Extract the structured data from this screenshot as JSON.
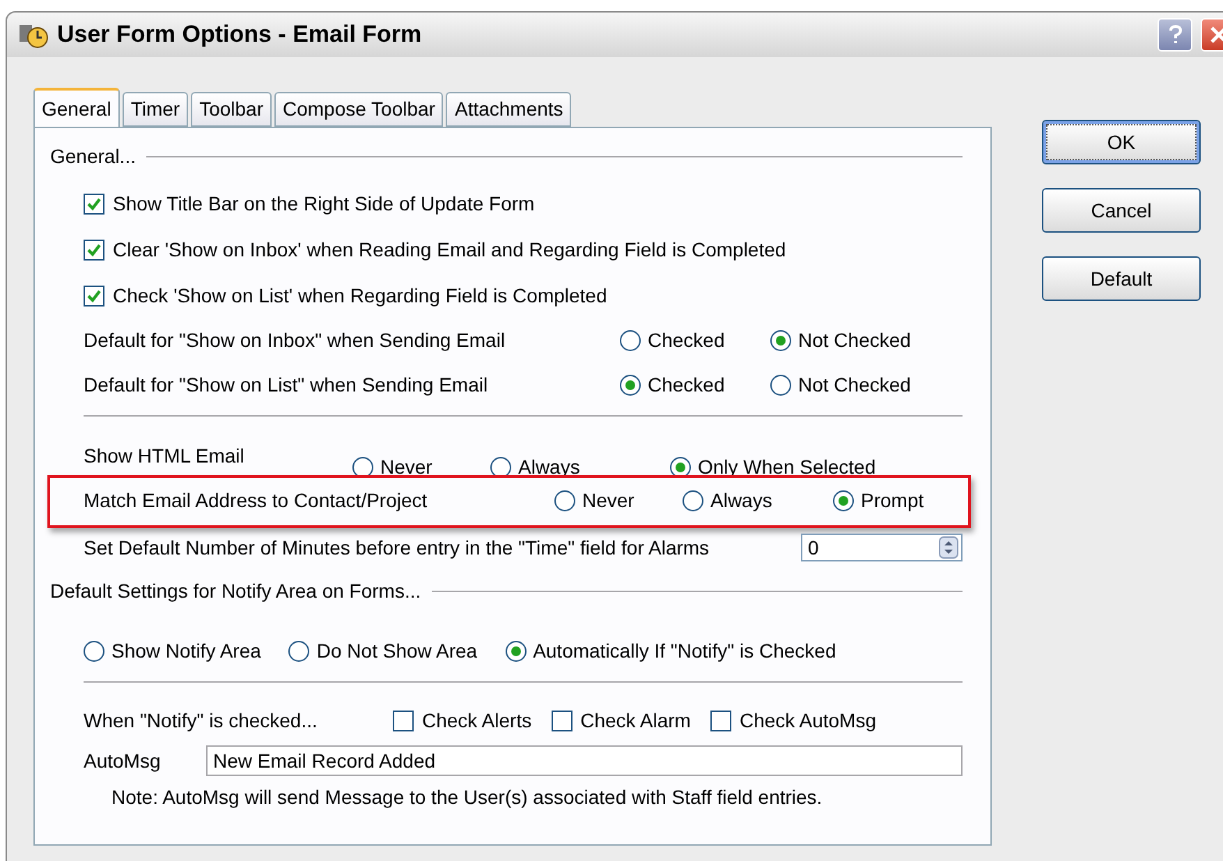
{
  "window": {
    "title": "User Form Options - Email Form"
  },
  "tabs": [
    {
      "label": "General",
      "selected": true
    },
    {
      "label": "Timer",
      "selected": false
    },
    {
      "label": "Toolbar",
      "selected": false
    },
    {
      "label": "Compose Toolbar",
      "selected": false
    },
    {
      "label": "Attachments",
      "selected": false
    }
  ],
  "buttons": [
    {
      "label": "OK",
      "focused": true
    },
    {
      "label": "Cancel",
      "focused": false
    },
    {
      "label": "Default",
      "focused": false
    }
  ],
  "general": {
    "heading": "General...",
    "checkboxes": [
      {
        "label": "Show Title Bar on the Right Side of Update Form",
        "checked": true
      },
      {
        "label": "Clear 'Show on Inbox' when Reading Email and Regarding Field is Completed",
        "checked": true
      },
      {
        "label": "Check 'Show on List' when Regarding Field is Completed",
        "checked": true
      }
    ],
    "radio_rows": [
      {
        "label": "Default for \"Show on Inbox\" when Sending Email",
        "highlighted": false,
        "options": [
          {
            "label": "Checked",
            "selected": false
          },
          {
            "label": "Not Checked",
            "selected": true
          }
        ]
      },
      {
        "label": "Default for \"Show on List\" when Sending Email",
        "highlighted": false,
        "options": [
          {
            "label": "Checked",
            "selected": true
          },
          {
            "label": "Not Checked",
            "selected": false
          }
        ]
      },
      {
        "label": "Show HTML Email",
        "highlighted": false,
        "options": [
          {
            "label": "Never",
            "selected": false
          },
          {
            "label": "Always",
            "selected": false
          },
          {
            "label": "Only When Selected",
            "selected": true
          }
        ]
      },
      {
        "label": "Match Email Address to Contact/Project",
        "highlighted": true,
        "options": [
          {
            "label": "Never",
            "selected": false
          },
          {
            "label": "Always",
            "selected": false
          },
          {
            "label": "Prompt",
            "selected": true
          }
        ]
      }
    ],
    "minutes": {
      "label": "Set Default Number of Minutes before entry in the \"Time\" field for Alarms",
      "value": "0"
    }
  },
  "notify": {
    "heading": "Default Settings for Notify Area on Forms...",
    "options": [
      {
        "label": "Show Notify Area",
        "selected": false
      },
      {
        "label": "Do Not Show Area",
        "selected": false
      },
      {
        "label": "Automatically If \"Notify\" is Checked",
        "selected": true
      }
    ],
    "when_label": "When \"Notify\" is checked...",
    "checks": [
      {
        "label": "Check Alerts",
        "checked": false
      },
      {
        "label": "Check Alarm",
        "checked": false
      },
      {
        "label": "Check AutoMsg",
        "checked": false
      }
    ],
    "automsg": {
      "label": "AutoMsg",
      "value": "New Email Record Added"
    },
    "note": "Note: AutoMsg will send Message to the User(s) associated with Staff field entries."
  }
}
